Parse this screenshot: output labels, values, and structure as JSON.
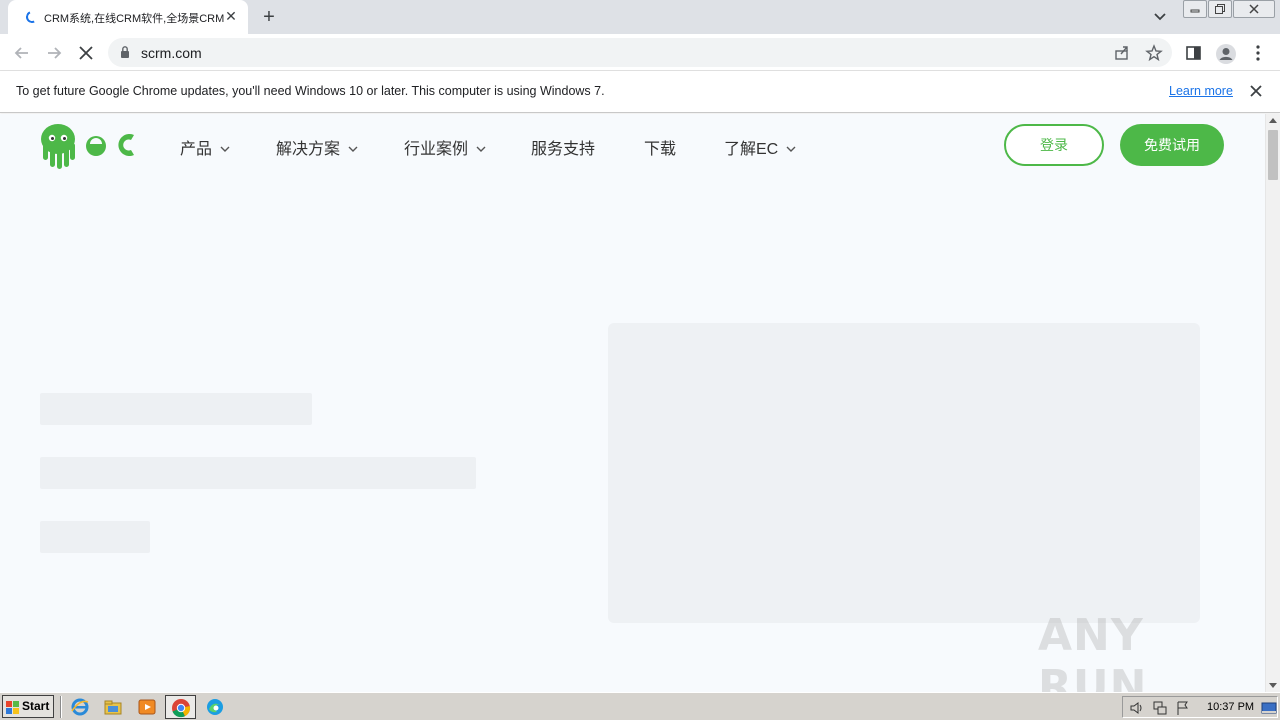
{
  "browser": {
    "tab_title": "CRM系统,在线CRM软件,全场景CRM",
    "url": "scrm.com",
    "infobar_message": "To get future Google Chrome updates, you'll need Windows 10 or later. This computer is using Windows 7.",
    "infobar_link": "Learn more"
  },
  "site": {
    "nav": [
      {
        "label": "产品",
        "has_dropdown": true
      },
      {
        "label": "解决方案",
        "has_dropdown": true
      },
      {
        "label": "行业案例",
        "has_dropdown": true
      },
      {
        "label": "服务支持",
        "has_dropdown": false
      },
      {
        "label": "下载",
        "has_dropdown": false
      },
      {
        "label": "了解EC",
        "has_dropdown": true
      }
    ],
    "login_label": "登录",
    "trial_label": "免费试用",
    "brand_color": "#4db848",
    "loading_state": "skeleton"
  },
  "watermark": "ANY RUN",
  "taskbar": {
    "start_label": "Start",
    "clock": "10:37 PM"
  }
}
